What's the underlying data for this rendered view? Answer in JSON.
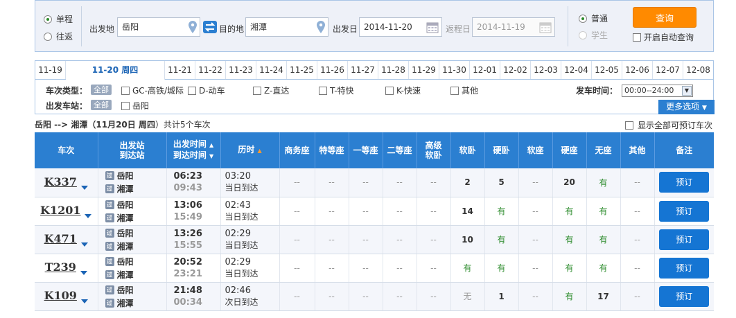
{
  "search": {
    "trip_types": [
      "单程",
      "往返"
    ],
    "from_label": "出发地",
    "from_value": "岳阳",
    "to_label": "目的地",
    "to_value": "湘潭",
    "depart_label": "出发日",
    "depart_value": "2014-11-20",
    "return_label": "返程日",
    "return_value": "2014-11-19",
    "passenger_types": [
      "普通",
      "学生"
    ],
    "query_label": "查询",
    "auto_query_label": "开启自动查询"
  },
  "date_tabs": [
    "11-19",
    "11-20 周四",
    "11-21",
    "11-22",
    "11-23",
    "11-24",
    "11-25",
    "11-26",
    "11-27",
    "11-28",
    "11-29",
    "11-30",
    "12-01",
    "12-02",
    "12-03",
    "12-04",
    "12-05",
    "12-06",
    "12-07",
    "12-08"
  ],
  "filters": {
    "type_label": "车次类型：",
    "all_label": "全部",
    "types": [
      "GC-高铁/城际",
      "D-动车",
      "Z-直达",
      "T-特快",
      "K-快速",
      "其他"
    ],
    "station_label": "出发车站：",
    "stations": [
      "岳阳"
    ],
    "time_label": "发车时间：",
    "time_value": "00:00--24:00",
    "more_label": "更多选项"
  },
  "route": {
    "prefix": "岳阳 --> 湘潭（",
    "date": "11月20日  周四",
    "suffix": "）共计5个车次"
  },
  "show_all_label": "显示全部可预订车次",
  "table": {
    "headers": {
      "train": "车次",
      "station1": "出发站",
      "station2": "到达站",
      "time1": "出发时间",
      "time2": "到达时间",
      "duration": "历时",
      "seats": [
        "商务座",
        "特等座",
        "一等座",
        "二等座",
        "高级\n软卧",
        "软卧",
        "硬卧",
        "软座",
        "硬座",
        "无座",
        "其他"
      ],
      "remark": "备注"
    },
    "rows": [
      {
        "train": "K337",
        "from": "岳阳",
        "to": "湘潭",
        "dep": "06:23",
        "arr": "09:43",
        "dur": "03:20",
        "day": "当日到达",
        "seats": [
          "--",
          "--",
          "--",
          "--",
          "--",
          "2",
          "5",
          "--",
          "20",
          "有",
          "--"
        ],
        "book": "预订"
      },
      {
        "train": "K1201",
        "from": "岳阳",
        "to": "湘潭",
        "dep": "13:06",
        "arr": "15:49",
        "dur": "02:43",
        "day": "当日到达",
        "seats": [
          "--",
          "--",
          "--",
          "--",
          "--",
          "14",
          "有",
          "--",
          "有",
          "有",
          "--"
        ],
        "book": "预订"
      },
      {
        "train": "K471",
        "from": "岳阳",
        "to": "湘潭",
        "dep": "13:26",
        "arr": "15:55",
        "dur": "02:29",
        "day": "当日到达",
        "seats": [
          "--",
          "--",
          "--",
          "--",
          "--",
          "10",
          "有",
          "--",
          "有",
          "有",
          "--"
        ],
        "book": "预订"
      },
      {
        "train": "T239",
        "from": "岳阳",
        "to": "湘潭",
        "dep": "20:52",
        "arr": "23:21",
        "dur": "02:29",
        "day": "当日到达",
        "seats": [
          "--",
          "--",
          "--",
          "--",
          "--",
          "有",
          "有",
          "--",
          "有",
          "有",
          "--"
        ],
        "book": "预订"
      },
      {
        "train": "K109",
        "from": "岳阳",
        "to": "湘潭",
        "dep": "21:48",
        "arr": "00:34",
        "dur": "02:46",
        "day": "次日到达",
        "seats": [
          "--",
          "--",
          "--",
          "--",
          "--",
          "无",
          "1",
          "--",
          "有",
          "17",
          "--"
        ],
        "book": "预订"
      }
    ]
  },
  "colors": {
    "accent": "#2b7fd1",
    "query": "#ff8a00",
    "available": "#2a8a2a"
  }
}
